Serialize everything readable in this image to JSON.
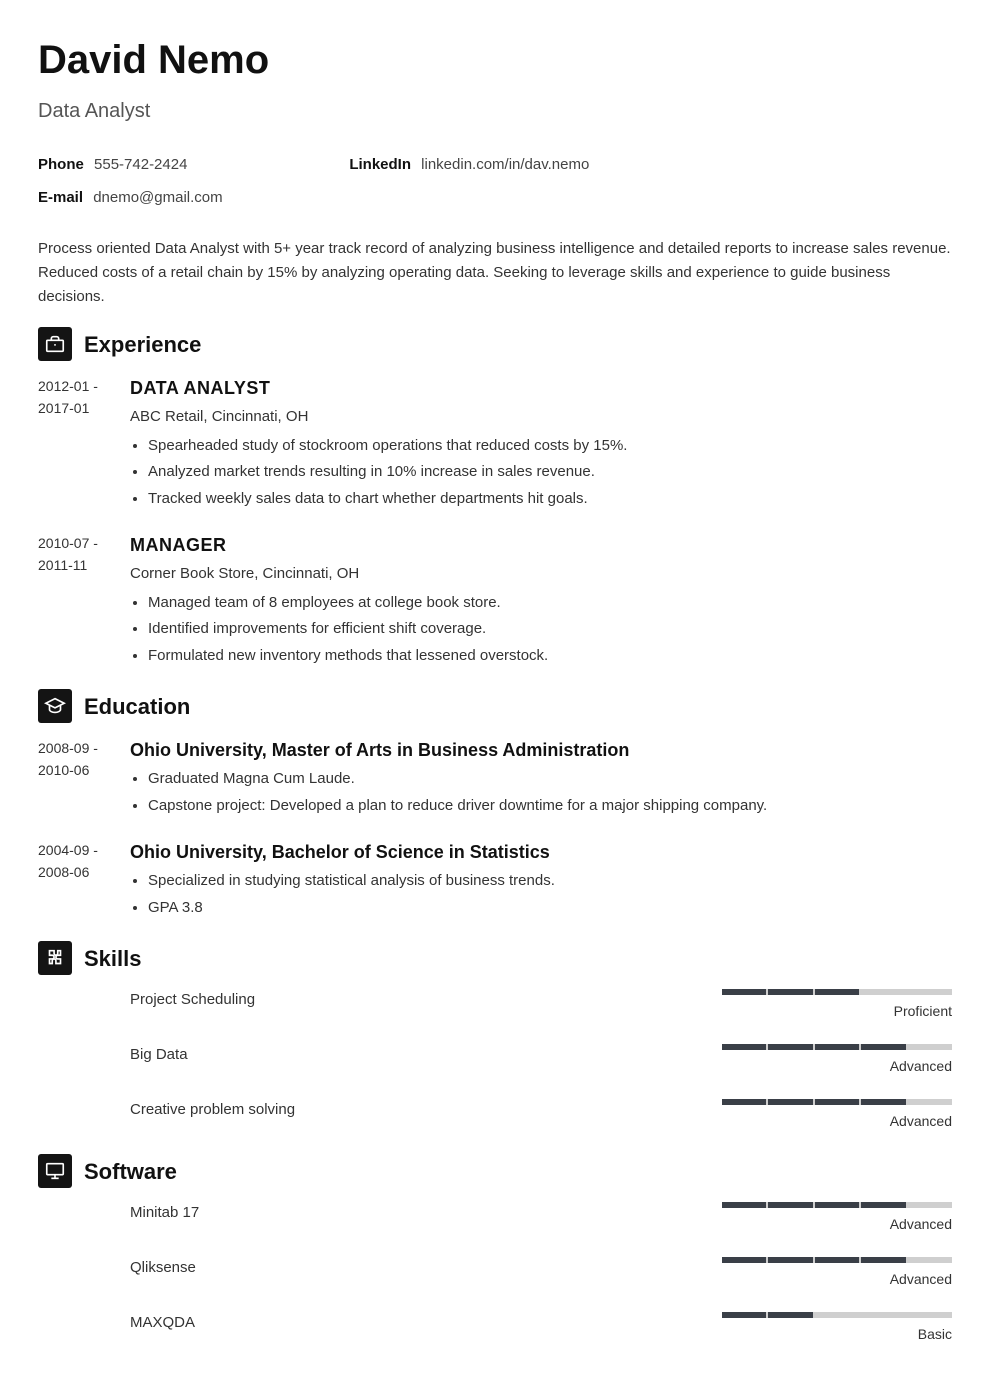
{
  "name": "David Nemo",
  "title": "Data Analyst",
  "contacts": {
    "phone_label": "Phone",
    "phone_value": "555-742-2424",
    "linkedin_label": "LinkedIn",
    "linkedin_value": "linkedin.com/in/dav.nemo",
    "email_label": "E-mail",
    "email_value": "dnemo@gmail.com"
  },
  "summary": "Process oriented Data Analyst with 5+ year track record of analyzing business intelligence and detailed reports to increase sales revenue. Reduced costs of a retail chain by 15% by analyzing operating data. Seeking to leverage skills and experience to guide business decisions.",
  "sections": {
    "experience_title": "Experience",
    "education_title": "Education",
    "skills_title": "Skills",
    "software_title": "Software"
  },
  "experience": [
    {
      "date_start": "2012-01 -",
      "date_end": "2017-01",
      "role": "DATA ANALYST",
      "company": "ABC Retail, Cincinnati, OH",
      "bullets": [
        "Spearheaded study of stockroom operations that reduced costs by 15%.",
        "Analyzed market trends resulting in 10% increase in sales revenue.",
        "Tracked weekly sales data to chart whether departments hit goals."
      ]
    },
    {
      "date_start": "2010-07 -",
      "date_end": "2011-11",
      "role": "MANAGER",
      "company": "Corner Book Store, Cincinnati, OH",
      "bullets": [
        "Managed team of 8 employees at college book store.",
        "Identified improvements for efficient shift coverage.",
        "Formulated new inventory methods that lessened overstock."
      ]
    }
  ],
  "education": [
    {
      "date_start": "2008-09 -",
      "date_end": "2010-06",
      "degree": "Ohio University, Master of Arts in Business Administration",
      "bullets": [
        "Graduated Magna Cum Laude.",
        "Capstone project: Developed a plan to reduce driver downtime for a major shipping company."
      ]
    },
    {
      "date_start": "2004-09 -",
      "date_end": "2008-06",
      "degree": "Ohio University, Bachelor of Science in Statistics",
      "bullets": [
        "Specialized in studying statistical analysis of business trends.",
        "GPA 3.8"
      ]
    }
  ],
  "skills": [
    {
      "name": "Project Scheduling",
      "level": "Proficient",
      "filled": 3,
      "total": 5
    },
    {
      "name": "Big Data",
      "level": "Advanced",
      "filled": 4,
      "total": 5
    },
    {
      "name": "Creative problem solving",
      "level": "Advanced",
      "filled": 4,
      "total": 5
    }
  ],
  "software": [
    {
      "name": "Minitab 17",
      "level": "Advanced",
      "filled": 4,
      "total": 5
    },
    {
      "name": "Qliksense",
      "level": "Advanced",
      "filled": 4,
      "total": 5
    },
    {
      "name": "MAXQDA",
      "level": "Basic",
      "filled": 2,
      "total": 5
    }
  ]
}
